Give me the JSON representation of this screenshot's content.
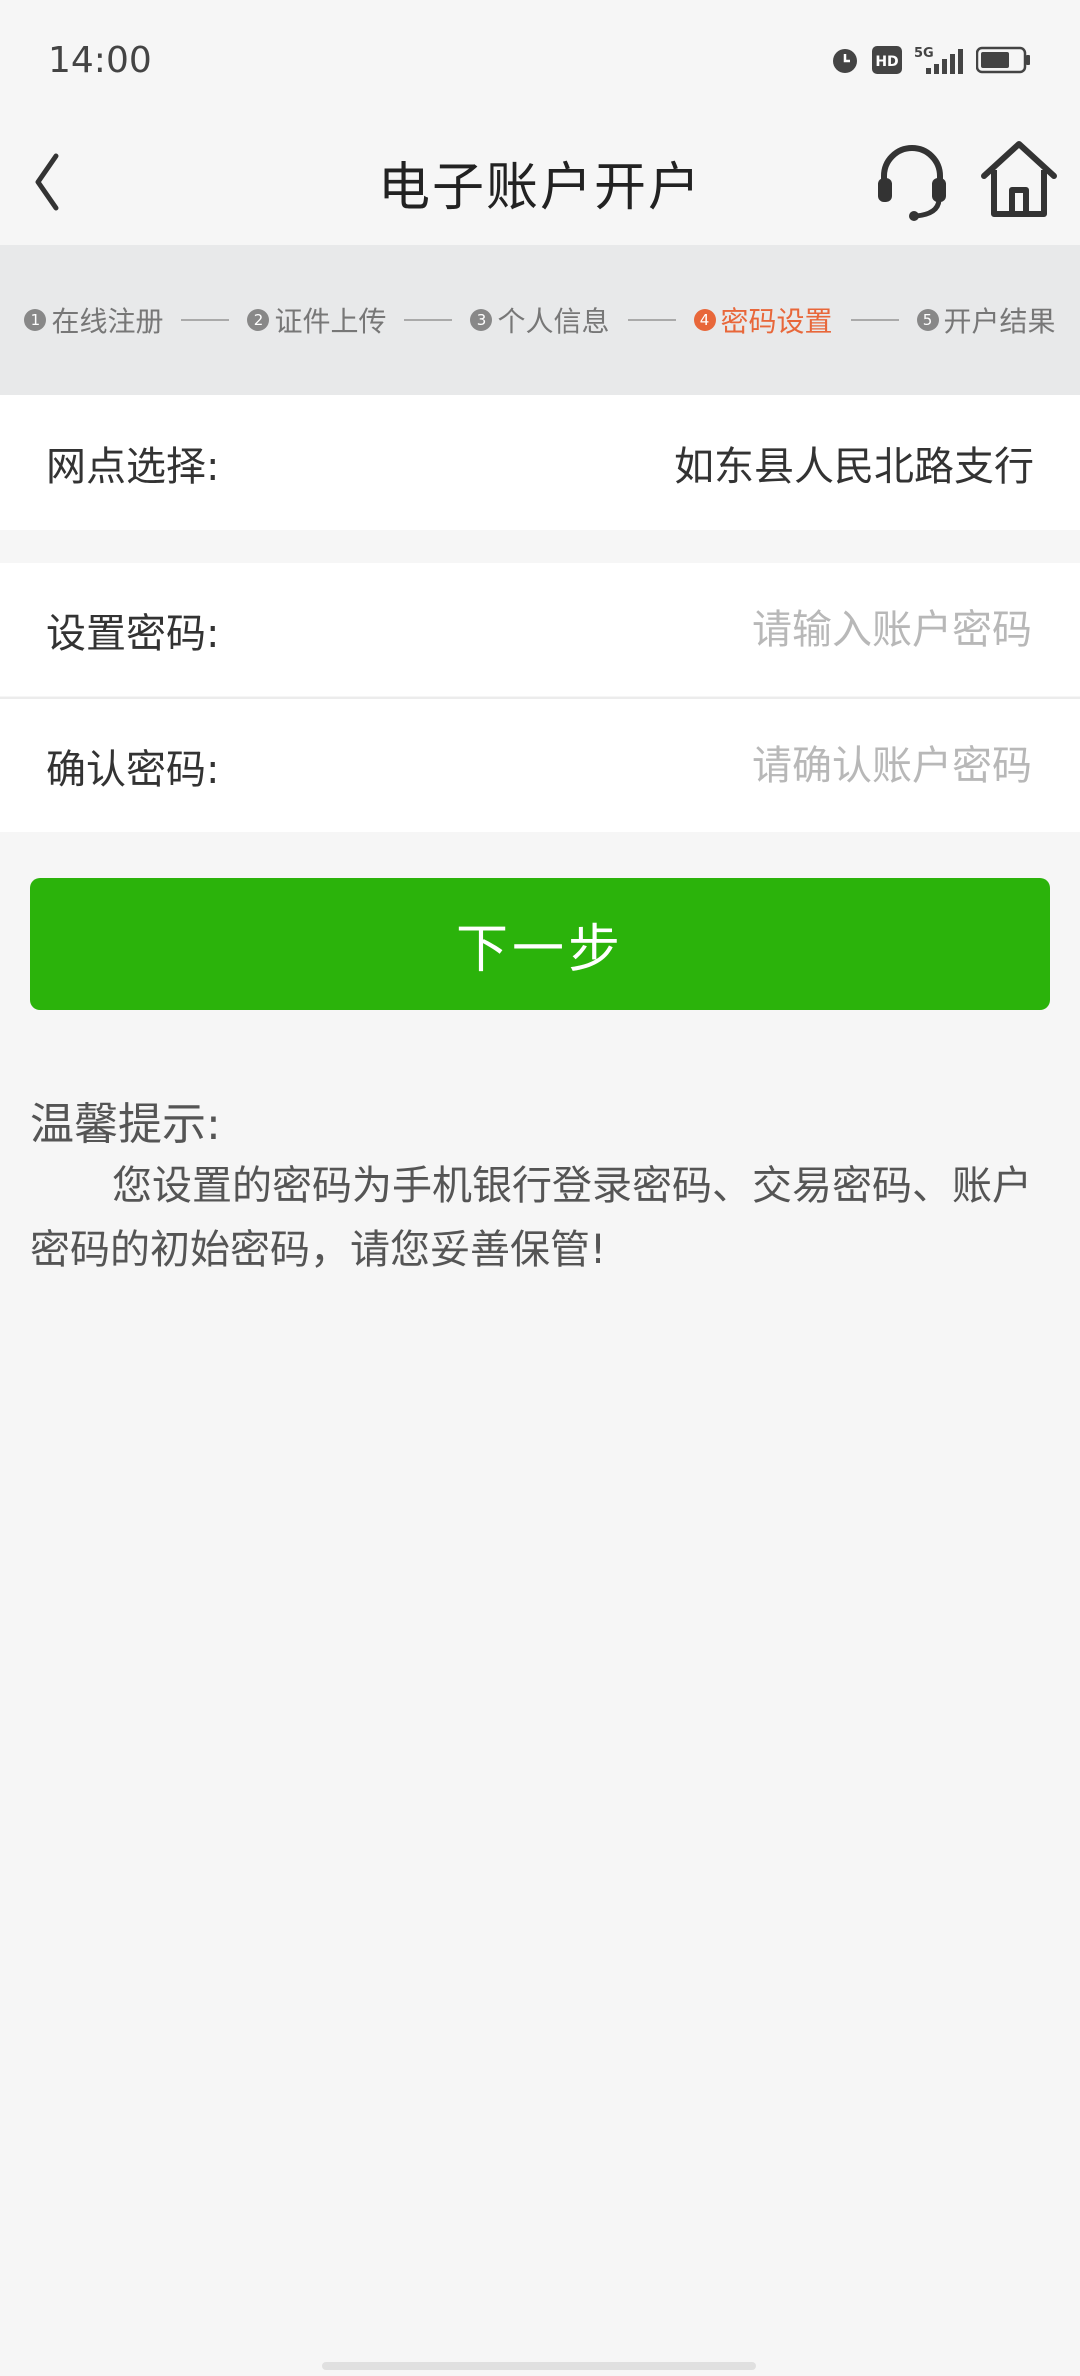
{
  "status_bar": {
    "time": "14:00",
    "icons": [
      "alarm-icon",
      "hd-icon",
      "5g-signal-icon",
      "battery-icon"
    ]
  },
  "nav": {
    "title": "电子账户开户",
    "back_icon": "chevron-left-icon",
    "support_icon": "headset-icon",
    "home_icon": "home-icon"
  },
  "steps": [
    {
      "num": "1",
      "label": "在线注册",
      "active": false
    },
    {
      "num": "2",
      "label": "证件上传",
      "active": false
    },
    {
      "num": "3",
      "label": "个人信息",
      "active": false
    },
    {
      "num": "4",
      "label": "密码设置",
      "active": true
    },
    {
      "num": "5",
      "label": "开户结果",
      "active": false
    }
  ],
  "branch": {
    "label": "网点选择:",
    "value": "如东县人民北路支行"
  },
  "password": {
    "label": "设置密码:",
    "placeholder": "请输入账户密码",
    "value": ""
  },
  "confirm": {
    "label": "确认密码:",
    "placeholder": "请确认账户密码",
    "value": ""
  },
  "next_button": "下一步",
  "tip": {
    "title": "温馨提示:",
    "body": "您设置的密码为手机银行登录密码、交易密码、账户密码的初始密码，请您妥善保管!"
  },
  "colors": {
    "primary_green": "#2bb30b",
    "active_step": "#e8673a",
    "background": "#f6f6f6"
  }
}
